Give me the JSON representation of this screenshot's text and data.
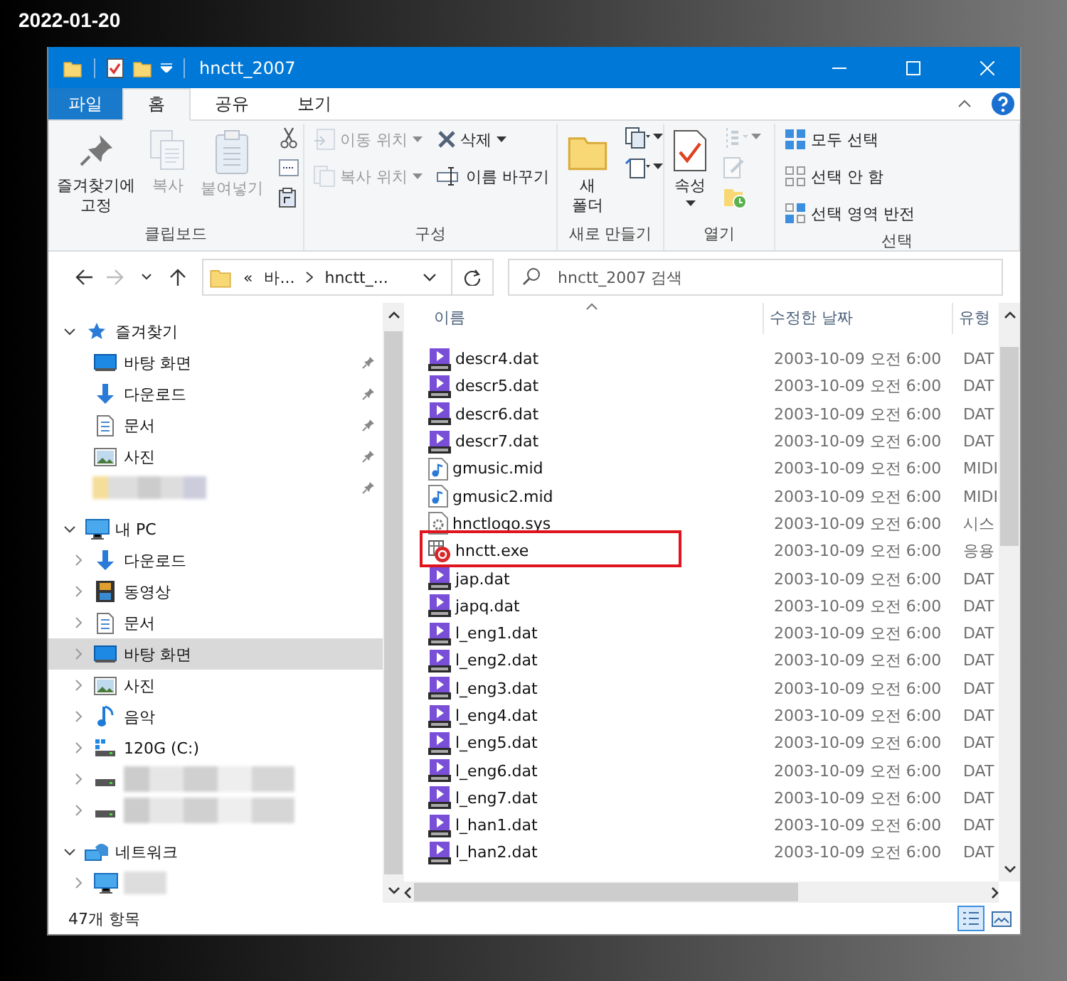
{
  "date": "2022-01-20",
  "window": {
    "title": "hnctt_2007"
  },
  "ribbon_tabs": [
    {
      "label": "파일",
      "kind": "file",
      "selected": false
    },
    {
      "label": "홈",
      "kind": "tab",
      "selected": true
    },
    {
      "label": "공유",
      "kind": "tab",
      "selected": false
    },
    {
      "label": "보기",
      "kind": "tab",
      "selected": false
    }
  ],
  "ribbon_groups": [
    {
      "label": "클립보드",
      "columns": [
        [
          {
            "kind": "large",
            "label": "즐겨찾기에 고정",
            "disabled": false,
            "dropdown": false
          }
        ],
        [
          {
            "kind": "large",
            "label": "복사",
            "disabled": true,
            "dropdown": false
          }
        ],
        [
          {
            "kind": "large",
            "label": "붙여넣기",
            "disabled": true,
            "dropdown": false
          }
        ],
        [
          {
            "kind": "icon",
            "disabled": false,
            "dropdown": false
          },
          {
            "kind": "icon",
            "disabled": false,
            "dropdown": false
          },
          {
            "kind": "icon",
            "disabled": false,
            "dropdown": false
          }
        ]
      ]
    },
    {
      "label": "구성",
      "columns": [
        [
          {
            "kind": "small",
            "label": "이동 위치",
            "disabled": true,
            "dropdown": true
          },
          {
            "kind": "small",
            "label": "복사 위치",
            "disabled": true,
            "dropdown": true
          }
        ],
        [
          {
            "kind": "small",
            "label": "삭제",
            "disabled": false,
            "dropdown": true
          },
          {
            "kind": "small",
            "label": "이름 바꾸기",
            "disabled": false,
            "dropdown": false
          }
        ]
      ]
    },
    {
      "label": "새로 만들기",
      "columns": [
        [
          {
            "kind": "large",
            "label": "새 폴더",
            "disabled": false,
            "dropdown": false
          }
        ],
        [
          {
            "kind": "icon",
            "disabled": false,
            "dropdown": true
          },
          {
            "kind": "icon",
            "disabled": false,
            "dropdown": true
          }
        ]
      ]
    },
    {
      "label": "열기",
      "columns": [
        [
          {
            "kind": "large",
            "label": "속성",
            "disabled": false,
            "dropdown": true
          }
        ],
        [
          {
            "kind": "icon",
            "disabled": true,
            "dropdown": true
          },
          {
            "kind": "icon",
            "disabled": true,
            "dropdown": false
          },
          {
            "kind": "icon",
            "disabled": false,
            "dropdown": false
          }
        ]
      ]
    },
    {
      "label": "선택",
      "columns": [
        [
          {
            "kind": "small",
            "label": "모두 선택",
            "disabled": false,
            "dropdown": false
          },
          {
            "kind": "small",
            "label": "선택 안 함",
            "disabled": false,
            "dropdown": false
          },
          {
            "kind": "small",
            "label": "선택 영역 반전",
            "disabled": false,
            "dropdown": false
          }
        ]
      ]
    }
  ],
  "address": {
    "overflow": "«",
    "path": [
      "바...",
      "hnctt_..."
    ],
    "search_placeholder": "hnctt_2007 검색"
  },
  "nav": [
    {
      "label": "즐겨찾기",
      "kind": "favorites",
      "expanded": true,
      "selected": false,
      "children": [
        {
          "label": "바탕 화면",
          "kind": "desktop",
          "pinned": true,
          "selected": false
        },
        {
          "label": "다운로드",
          "kind": "download",
          "pinned": true,
          "selected": false
        },
        {
          "label": "문서",
          "kind": "documents",
          "pinned": true,
          "selected": false
        },
        {
          "label": "사진",
          "kind": "pictures",
          "pinned": true,
          "selected": false
        },
        {
          "kind": "redacted",
          "pinned": true,
          "selected": false
        }
      ]
    },
    {
      "label": "내 PC",
      "kind": "pc",
      "expanded": true,
      "selected": false,
      "children": [
        {
          "label": "다운로드",
          "kind": "download",
          "expanded": false,
          "selected": false
        },
        {
          "label": "동영상",
          "kind": "videos",
          "expanded": false,
          "selected": false
        },
        {
          "label": "문서",
          "kind": "documents",
          "expanded": false,
          "selected": false
        },
        {
          "label": "바탕 화면",
          "kind": "desktop",
          "expanded": false,
          "selected": true
        },
        {
          "label": "사진",
          "kind": "pictures",
          "expanded": false,
          "selected": false
        },
        {
          "label": "음악",
          "kind": "music",
          "expanded": false,
          "selected": false
        },
        {
          "label": "120G (C:)",
          "kind": "system-drive",
          "expanded": false,
          "selected": false
        },
        {
          "kind": "redacted-drive",
          "expanded": false,
          "selected": false
        },
        {
          "kind": "redacted-drive",
          "expanded": false,
          "selected": false
        }
      ]
    },
    {
      "label": "네트워크",
      "kind": "network",
      "expanded": true,
      "selected": false,
      "children": [
        {
          "kind": "redacted-computer",
          "expanded": false,
          "selected": false
        }
      ]
    }
  ],
  "columns": [
    "이름",
    "수정한 날짜",
    "유형"
  ],
  "files": [
    {
      "name": "descr4.dat",
      "kind": "dat",
      "modified": "2003-10-09 오전 6:00",
      "type": "DAT",
      "highlighted": false
    },
    {
      "name": "descr5.dat",
      "kind": "dat",
      "modified": "2003-10-09 오전 6:00",
      "type": "DAT",
      "highlighted": false
    },
    {
      "name": "descr6.dat",
      "kind": "dat",
      "modified": "2003-10-09 오전 6:00",
      "type": "DAT",
      "highlighted": false
    },
    {
      "name": "descr7.dat",
      "kind": "dat",
      "modified": "2003-10-09 오전 6:00",
      "type": "DAT",
      "highlighted": false
    },
    {
      "name": "gmusic.mid",
      "kind": "midi",
      "modified": "2003-10-09 오전 6:00",
      "type": "MIDI",
      "highlighted": false
    },
    {
      "name": "gmusic2.mid",
      "kind": "midi",
      "modified": "2003-10-09 오전 6:00",
      "type": "MIDI",
      "highlighted": false
    },
    {
      "name": "hnctlogo.sys",
      "kind": "sys",
      "modified": "2003-10-09 오전 6:00",
      "type": "시스",
      "highlighted": false
    },
    {
      "name": "hnctt.exe",
      "kind": "exe",
      "modified": "2003-10-09 오전 6:00",
      "type": "응용",
      "highlighted": true
    },
    {
      "name": "jap.dat",
      "kind": "dat",
      "modified": "2003-10-09 오전 6:00",
      "type": "DAT",
      "highlighted": false
    },
    {
      "name": "japq.dat",
      "kind": "dat",
      "modified": "2003-10-09 오전 6:00",
      "type": "DAT",
      "highlighted": false
    },
    {
      "name": "l_eng1.dat",
      "kind": "dat",
      "modified": "2003-10-09 오전 6:00",
      "type": "DAT",
      "highlighted": false
    },
    {
      "name": "l_eng2.dat",
      "kind": "dat",
      "modified": "2003-10-09 오전 6:00",
      "type": "DAT",
      "highlighted": false
    },
    {
      "name": "l_eng3.dat",
      "kind": "dat",
      "modified": "2003-10-09 오전 6:00",
      "type": "DAT",
      "highlighted": false
    },
    {
      "name": "l_eng4.dat",
      "kind": "dat",
      "modified": "2003-10-09 오전 6:00",
      "type": "DAT",
      "highlighted": false
    },
    {
      "name": "l_eng5.dat",
      "kind": "dat",
      "modified": "2003-10-09 오전 6:00",
      "type": "DAT",
      "highlighted": false
    },
    {
      "name": "l_eng6.dat",
      "kind": "dat",
      "modified": "2003-10-09 오전 6:00",
      "type": "DAT",
      "highlighted": false
    },
    {
      "name": "l_eng7.dat",
      "kind": "dat",
      "modified": "2003-10-09 오전 6:00",
      "type": "DAT",
      "highlighted": false
    },
    {
      "name": "l_han1.dat",
      "kind": "dat",
      "modified": "2003-10-09 오전 6:00",
      "type": "DAT",
      "highlighted": false
    },
    {
      "name": "l_han2.dat",
      "kind": "dat",
      "modified": "2003-10-09 오전 6:00",
      "type": "DAT",
      "highlighted": false
    }
  ],
  "status": {
    "count": "47개 항목"
  },
  "view_buttons": [
    {
      "kind": "details",
      "selected": true
    },
    {
      "kind": "thumbnails",
      "selected": false
    }
  ]
}
